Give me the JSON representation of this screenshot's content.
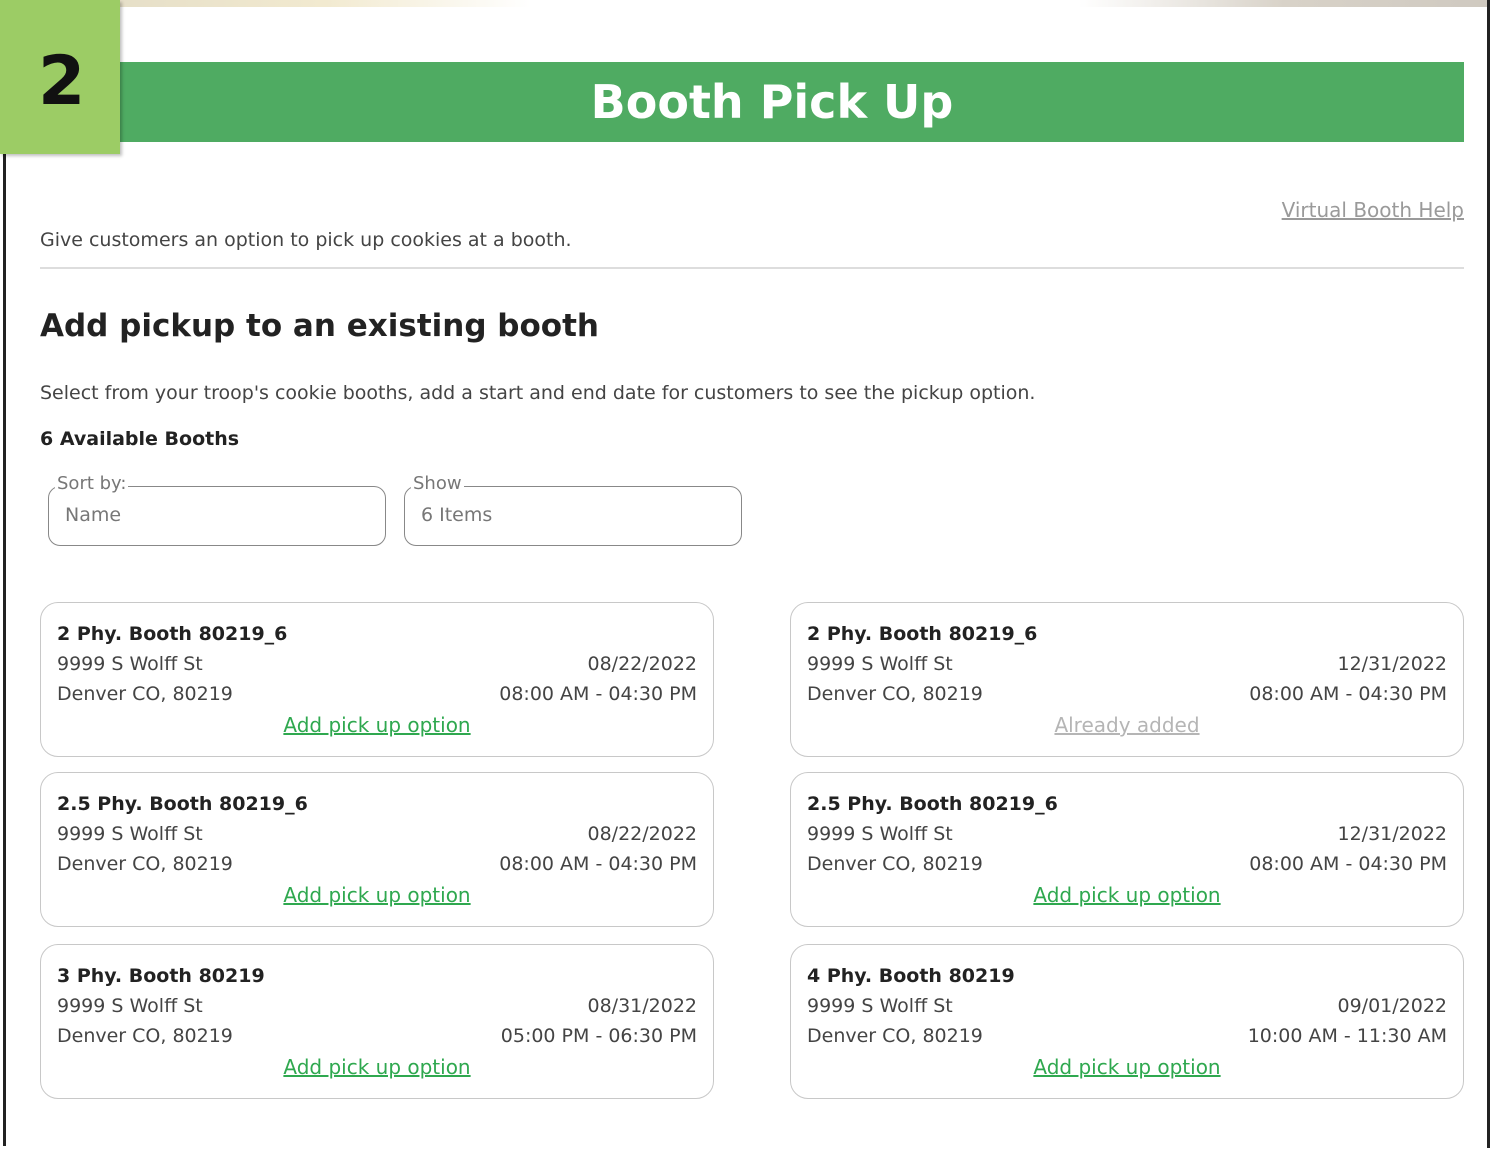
{
  "step": {
    "number": "2"
  },
  "header": {
    "title": "Booth Pick Up"
  },
  "help_link": "Virtual Booth Help",
  "intro": "Give customers an option to pick up cookies at a booth.",
  "section": {
    "title": "Add pickup to an existing booth",
    "description": "Select from your troop's cookie booths, add a start and end date for customers to see the pickup option.",
    "count_label": "6 Available Booths"
  },
  "filters": {
    "sort": {
      "label": "Sort by:",
      "value": "Name"
    },
    "show": {
      "label": "Show",
      "value": "6 Items"
    }
  },
  "booths": [
    {
      "title": "2 Phy. Booth 80219_6",
      "street": "9999 S Wolff St",
      "city": "Denver CO, 80219",
      "date": "08/22/2022",
      "time": "08:00 AM - 04:30 PM",
      "action": "Add pick up option"
    },
    {
      "title": "2 Phy. Booth 80219_6",
      "street": "9999 S Wolff St",
      "city": "Denver CO, 80219",
      "date": "12/31/2022",
      "time": "08:00 AM - 04:30 PM",
      "action": "Already added"
    },
    {
      "title": "2.5 Phy. Booth 80219_6",
      "street": "9999 S Wolff St",
      "city": "Denver CO, 80219",
      "date": "08/22/2022",
      "time": "08:00 AM - 04:30 PM",
      "action": "Add pick up option"
    },
    {
      "title": "2.5 Phy. Booth 80219_6",
      "street": "9999 S Wolff St",
      "city": "Denver CO, 80219",
      "date": "12/31/2022",
      "time": "08:00 AM - 04:30 PM",
      "action": "Add pick up option"
    },
    {
      "title": "3 Phy. Booth 80219",
      "street": "9999 S Wolff St",
      "city": "Denver CO, 80219",
      "date": "08/31/2022",
      "time": "05:00 PM - 06:30 PM",
      "action": "Add pick up option"
    },
    {
      "title": "4 Phy. Booth 80219",
      "street": "9999 S Wolff St",
      "city": "Denver CO, 80219",
      "date": "09/01/2022",
      "time": "10:00 AM - 11:30 AM",
      "action": "Add pick up option"
    }
  ],
  "colors": {
    "header_green": "#4fab62",
    "badge_green": "#9ccc65",
    "link_green": "#2fa84f",
    "disabled_gray": "#b5b5b5"
  }
}
